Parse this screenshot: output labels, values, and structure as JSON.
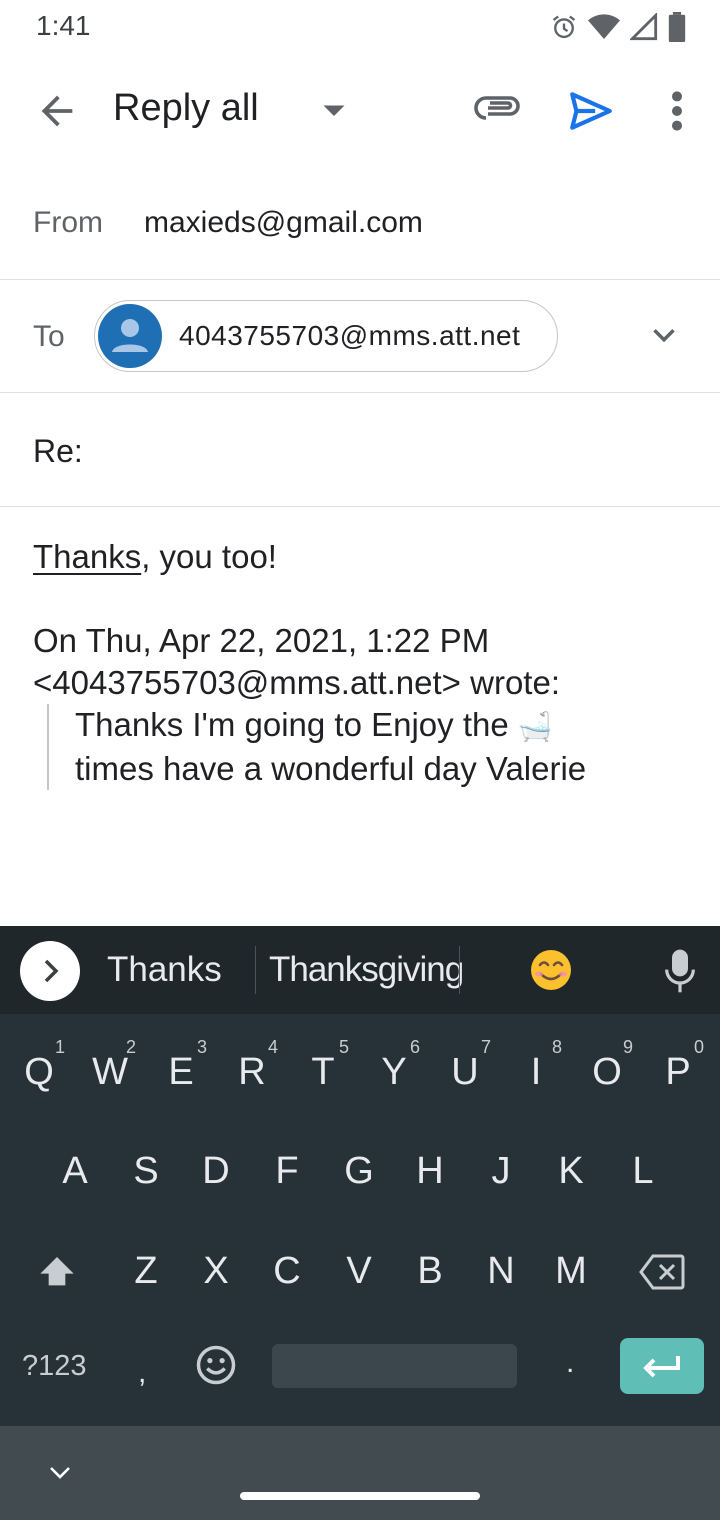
{
  "status_bar": {
    "time": "1:41"
  },
  "app_bar": {
    "title": "Reply all"
  },
  "compose": {
    "from_label": "From",
    "from_value": "maxieds@gmail.com",
    "to_label": "To",
    "to_chip": "4043755703@mms.att.net",
    "subject": "Re:",
    "reply_underlined": "Thanks",
    "reply_rest": ", you too!",
    "quote_header_line1": "On Thu, Apr 22, 2021, 1:22 PM",
    "quote_header_line2": "<4043755703@mms.att.net> wrote:",
    "quote_line1": "Thanks I'm going to Enjoy the",
    "quote_emoji": "🛁",
    "quote_line2": "times have a wonderful day Valerie"
  },
  "keyboard": {
    "suggestions": [
      "Thanks",
      "Thanksgiving"
    ],
    "suggestion_emoji": "😊",
    "row1": [
      {
        "key": "Q",
        "hint": "1"
      },
      {
        "key": "W",
        "hint": "2"
      },
      {
        "key": "E",
        "hint": "3"
      },
      {
        "key": "R",
        "hint": "4"
      },
      {
        "key": "T",
        "hint": "5"
      },
      {
        "key": "Y",
        "hint": "6"
      },
      {
        "key": "U",
        "hint": "7"
      },
      {
        "key": "I",
        "hint": "8"
      },
      {
        "key": "O",
        "hint": "9"
      },
      {
        "key": "P",
        "hint": "0"
      }
    ],
    "row2": [
      "A",
      "S",
      "D",
      "F",
      "G",
      "H",
      "J",
      "K",
      "L"
    ],
    "row3": [
      "Z",
      "X",
      "C",
      "V",
      "B",
      "N",
      "M"
    ],
    "symbols_label": "?123",
    "comma": ",",
    "period": ".",
    "accent_color": "#5fbfb6"
  },
  "icons": {
    "back": "arrow-back-icon",
    "dropdown": "caret-down-icon",
    "attach": "paperclip-icon",
    "send": "send-icon",
    "more": "more-vert-icon",
    "expand": "chevron-down-icon",
    "avatar": "person-icon",
    "mic": "mic-icon",
    "shift": "shift-icon",
    "backspace": "backspace-icon",
    "enter": "enter-icon",
    "emoji": "emoji-icon"
  }
}
